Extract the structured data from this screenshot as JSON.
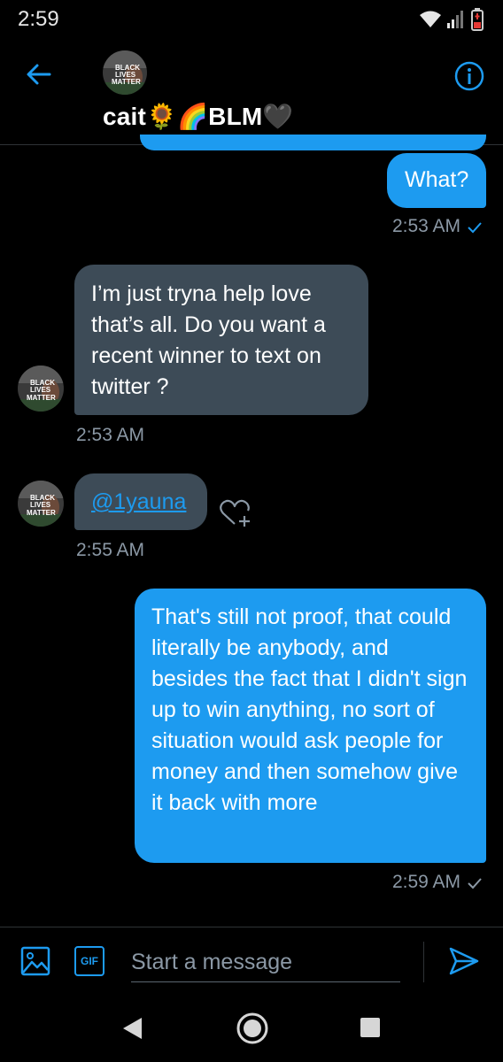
{
  "status_bar": {
    "time": "2:59"
  },
  "header": {
    "contact_name": "cait🌻🌈BLM🖤",
    "avatar_text": "BLACK LIVES MATTER"
  },
  "messages": [
    {
      "direction": "out",
      "text": "What?",
      "time": "2:53 AM"
    },
    {
      "direction": "in",
      "text": "I’m just tryna help love that’s all. Do you want a recent winner to text on twitter ?",
      "time": "2:53 AM"
    },
    {
      "direction": "in",
      "text": "@1yauna",
      "time": "2:55 AM"
    },
    {
      "direction": "out",
      "text": "That's still not proof, that could literally be anybody, and besides the fact that I didn't sign up to win anything, no sort of situation would ask people for money and then somehow give it back with more",
      "time": "2:59 AM"
    }
  ],
  "composer": {
    "placeholder": "Start a message",
    "gif_label": "GIF"
  },
  "colors": {
    "accent": "#1d9bf0",
    "incoming_bubble": "#3d4b57",
    "background": "#000000"
  }
}
